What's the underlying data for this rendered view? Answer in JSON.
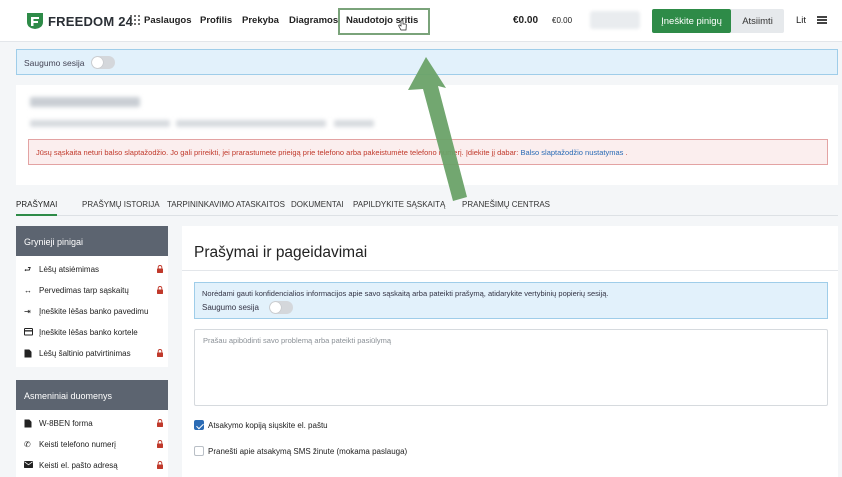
{
  "header": {
    "logo_text": "FREEDOM 24",
    "nav": [
      "Paslaugos",
      "Profilis",
      "Prekyba",
      "Diagramos",
      "Naudotojo sritis"
    ],
    "balance_main": "€0.00",
    "balance_secondary": "€0.00",
    "deposit_label": "Įneškite pinigų",
    "withdraw_label": "Atsiimti",
    "language": "Lit",
    "brand_color": "#2e8b48"
  },
  "session": {
    "label": "Saugumo sesija"
  },
  "warning": {
    "text": "Jūsų sąskaita neturi balso slaptažodžio. Jo gali prireikti, jei prarastumete prieigą prie telefono arba pakeistumėte telefono numerį. Įdiekite jį dabar:",
    "link": "Balso slaptažodžio nustatymas",
    "suffix": "."
  },
  "tabs": [
    "PRAŠYMAI",
    "PRAŠYMŲ ISTORIJA",
    "TARPININKAVIMO ATASKAITOS",
    "DOKUMENTAI",
    "PAPILDYKITE SĄSKAITĄ",
    "PRANEŠIMŲ CENTRAS"
  ],
  "sidebar": {
    "groups": [
      {
        "title": "Grynieji pinigai",
        "items": [
          {
            "label": "Lėšų atsiėmimas",
            "icon": "withdraw-icon",
            "locked": true
          },
          {
            "label": "Pervedimas tarp sąskaitų",
            "icon": "transfer-icon",
            "locked": true
          },
          {
            "label": "Įneškite lėšas banko pavedimu",
            "icon": "deposit-icon",
            "locked": false
          },
          {
            "label": "Įneškite lėšas banko kortele",
            "icon": "card-icon",
            "locked": false
          },
          {
            "label": "Lėšų šaltinio patvirtinimas",
            "icon": "document-icon",
            "locked": true
          }
        ]
      },
      {
        "title": "Asmeniniai duomenys",
        "items": [
          {
            "label": "W-8BEN forma",
            "icon": "document-icon",
            "locked": true
          },
          {
            "label": "Keisti telefono numerį",
            "icon": "phone-icon",
            "locked": true
          },
          {
            "label": "Keisti el. pašto adresą",
            "icon": "mail-icon",
            "locked": true
          }
        ]
      }
    ]
  },
  "main": {
    "title": "Prašymai ir pageidavimai",
    "info_text": "Norėdami gauti konfidencialios informacijos apie savo sąskaitą arba pateikti prašymą, atidarykite vertybinių popierių sesiją.",
    "info_session_label": "Saugumo sesija",
    "textarea_placeholder": "Prašau apibūdinti savo problemą arba pateikti pasiūlymą",
    "checkbox_email": "Atsakymo kopiją siųskite el. paštu",
    "checkbox_email_checked": true,
    "checkbox_sms": "Pranešti apie atsakymą SMS žinute (mokama paslauga)",
    "checkbox_sms_checked": false
  }
}
